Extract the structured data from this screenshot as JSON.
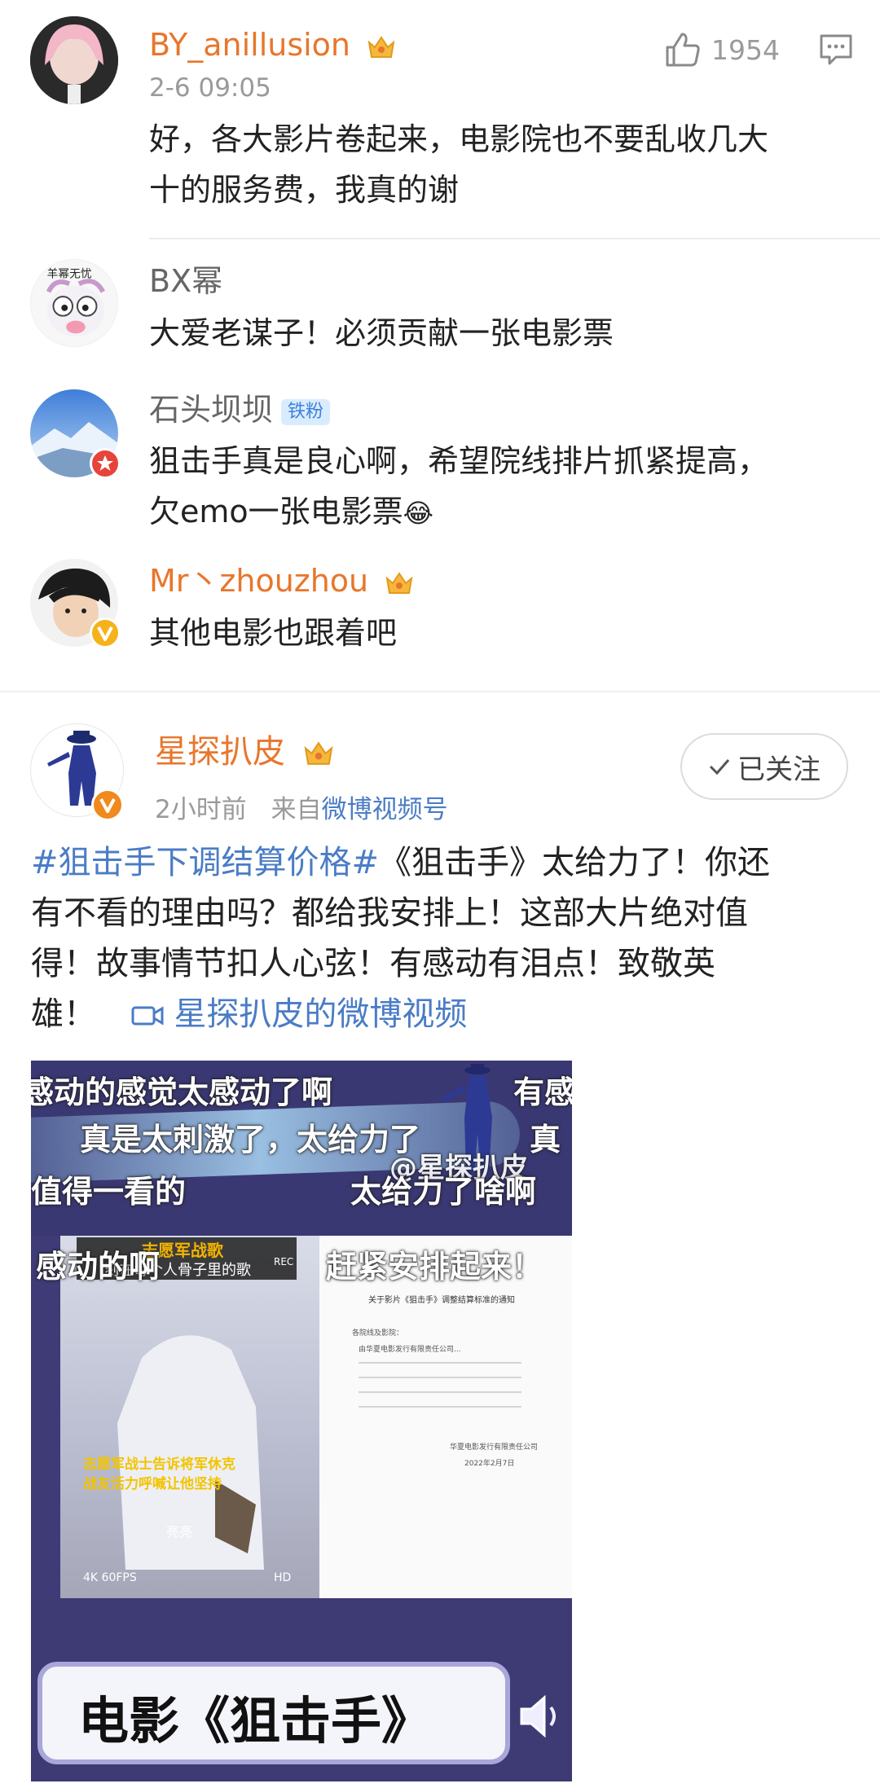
{
  "comments": [
    {
      "username": "BY_anillusion",
      "time": "2-6 09:05",
      "likes": "1954",
      "text_line1": "好，各大影片卷起来，电影院也不要乱收几大",
      "text_line2": "十的服务费，我真的谢"
    }
  ],
  "replies": [
    {
      "username": "BX幂",
      "text": "大爱老谋子！必须贡献一张电影票"
    },
    {
      "username": "石头坝坝",
      "badge": "铁粉",
      "text_line1": "狙击手真是良心啊，希望院线排片抓紧提高，",
      "text_line2": "欠emo一张电影票"
    },
    {
      "username": "Mr丶zhouzhou",
      "text": "其他电影也跟着吧"
    }
  ],
  "post": {
    "username": "星探扒皮",
    "time": "2小时前",
    "source_prefix": "来自",
    "source": "微博视频号",
    "follow_label": "已关注",
    "hashtag": "#狙击手下调结算价格#",
    "body_line1": "《狙击手》太给力了！你还",
    "body_line2": "有不看的理由吗？都给我安排上！这部大片绝对值",
    "body_line3": "得！故事情节扣人心弦！有感动有泪点！致敬英",
    "body_line4": "雄！",
    "video_link": "星探扒皮的微博视频"
  },
  "video": {
    "danmaku": [
      "感动的感觉太感动了啊",
      "有感",
      "真是太刺激了，太给力了",
      "真",
      "值得一看的",
      "太给力了啥啊",
      "感动的啊",
      "赶紧安排起来！"
    ],
    "watermark": "@星探扒皮",
    "inner_title1": "志愿军战歌",
    "inner_title2": "刻在每个人骨子里的歌",
    "inner_caption1": "志愿军战士告诉将军休克",
    "inner_caption2": "战友活力呼喊让他坚持",
    "inner_name": "亮亮",
    "inner_fps": "4K 60FPS",
    "inner_rec": "REC",
    "inner_hd": "HD",
    "doc_title": "关于影片《狙击手》调整结算标准的通知",
    "doc_line1": "各院线及影院：",
    "doc_line2": "由华夏电影发行有限责任公司...",
    "doc_sign": "华夏电影发行有限责任公司",
    "doc_date": "2022年2月7日",
    "banner": "电影《狙击手》"
  },
  "icons": [
    "thumbs-up-icon",
    "comment-icon",
    "crown-icon",
    "checkmark-icon",
    "video-camera-icon",
    "speaker-icon",
    "v-badge-icon"
  ],
  "colors": {
    "orange_name": "#e8762c",
    "link_blue": "#4a7cc6",
    "video_bg": "#3e3b76"
  }
}
